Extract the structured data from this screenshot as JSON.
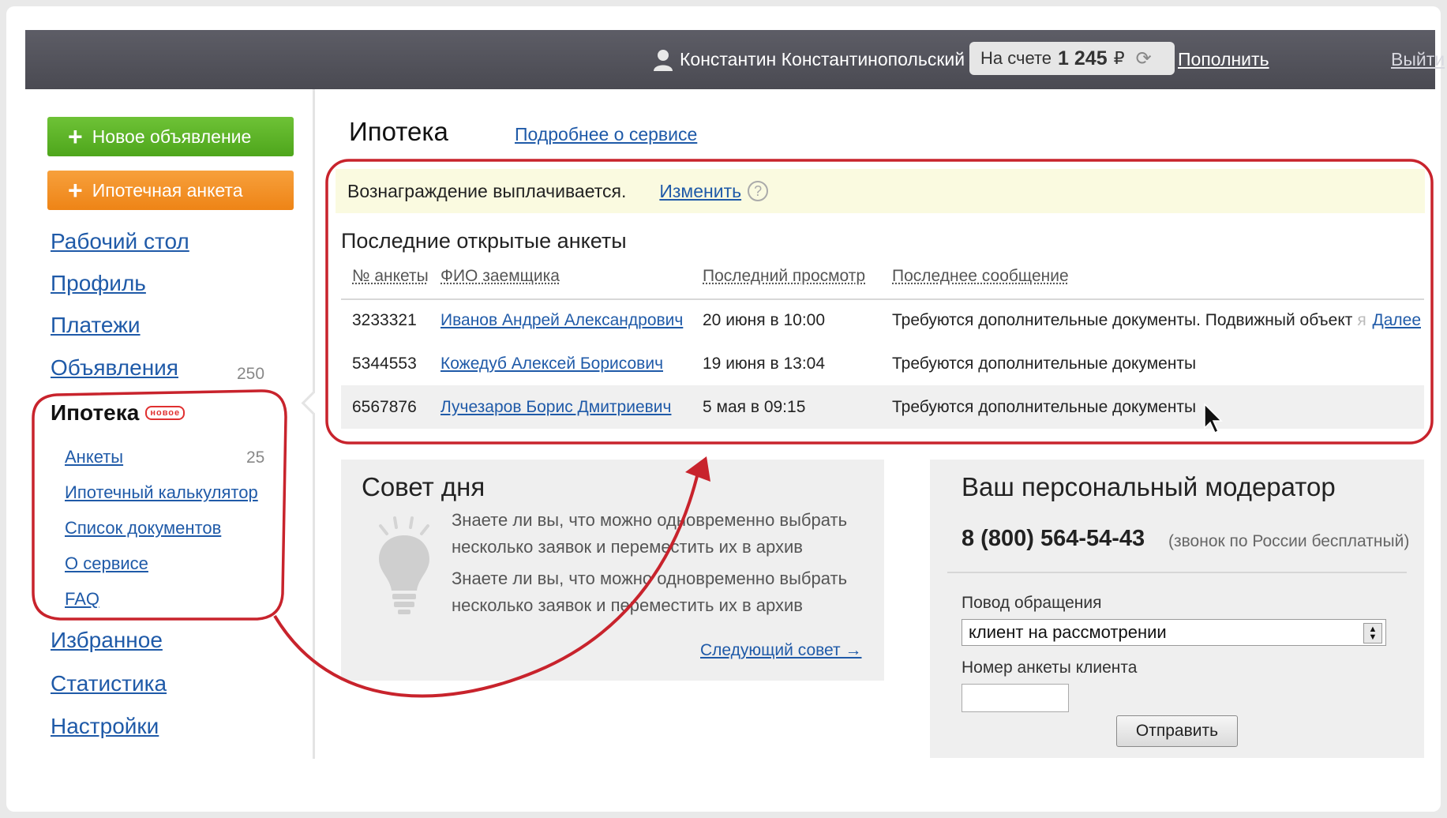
{
  "topbar": {
    "user_name": "Константин Константинопольский",
    "balance_prefix": "На счете",
    "balance_amount": "1 245",
    "currency": "₽",
    "topup_label": "Пополнить",
    "logout_label": "Выйти"
  },
  "sidebar": {
    "new_ad_label": "Новое объявление",
    "mortgage_form_label": "Ипотечная анкета",
    "items": [
      {
        "label": "Рабочий стол"
      },
      {
        "label": "Профиль"
      },
      {
        "label": "Платежи"
      },
      {
        "label": "Объявления",
        "count": "250"
      }
    ],
    "active": {
      "label": "Ипотека",
      "badge": "новое"
    },
    "subitems": [
      {
        "label": "Анкеты",
        "count": "25"
      },
      {
        "label": "Ипотечный калькулятор"
      },
      {
        "label": "Список документов"
      },
      {
        "label": "О сервисе"
      },
      {
        "label": "FAQ"
      }
    ],
    "bottom_items": [
      {
        "label": "Избранное"
      },
      {
        "label": "Статистика"
      },
      {
        "label": "Настройки"
      }
    ]
  },
  "main": {
    "title": "Ипотека",
    "about_link": "Подробнее о сервисе",
    "notice": {
      "text": "Вознаграждение выплачивается.",
      "change_link": "Изменить",
      "help": "?"
    },
    "recent_title": "Последние открытые анкеты",
    "columns": [
      "№ анкеты",
      "ФИО заемщика",
      "Последний просмотр",
      "Последнее сообщение"
    ],
    "rows": [
      {
        "id": "3233321",
        "name": "Иванов Андрей Александрович",
        "viewed": "20 июня в 10:00",
        "message": "Требуются дополнительные документы. Подвижный объект",
        "message_fade": "я",
        "more": "Далее"
      },
      {
        "id": "5344553",
        "name": "Кожедуб Алексей Борисович",
        "viewed": "19 июня в 13:04",
        "message": "Требуются дополнительные документы"
      },
      {
        "id": "6567876",
        "name": "Лучезаров Борис Дмитриевич",
        "viewed": "5 мая в 09:15",
        "message": "Требуются дополнительные документы"
      }
    ]
  },
  "tip": {
    "title": "Совет дня",
    "paragraphs": [
      "Знаете ли вы, что можно одновременно выбрать несколько заявок и переместить их в архив",
      "Знаете ли вы, что можно одновременно выбрать несколько заявок и переместить их в архив"
    ],
    "next_link": "Следующий совет →"
  },
  "moderator": {
    "title": "Ваш персональный модератор",
    "phone": "8 (800) 564-54-43",
    "phone_note": "(звонок по России бесплатный)",
    "reason_label": "Повод обращения",
    "reason_value": "клиент на рассмотрении",
    "form_number_label": "Номер анкеты клиента",
    "form_number_value": "",
    "submit_label": "Отправить"
  },
  "colors": {
    "topbar": "#52525a",
    "link": "#1f5aa8",
    "green_button": "#5bb326",
    "orange_button": "#f29225",
    "highlight": "#c8232c",
    "notice_bg": "#fafae0"
  }
}
